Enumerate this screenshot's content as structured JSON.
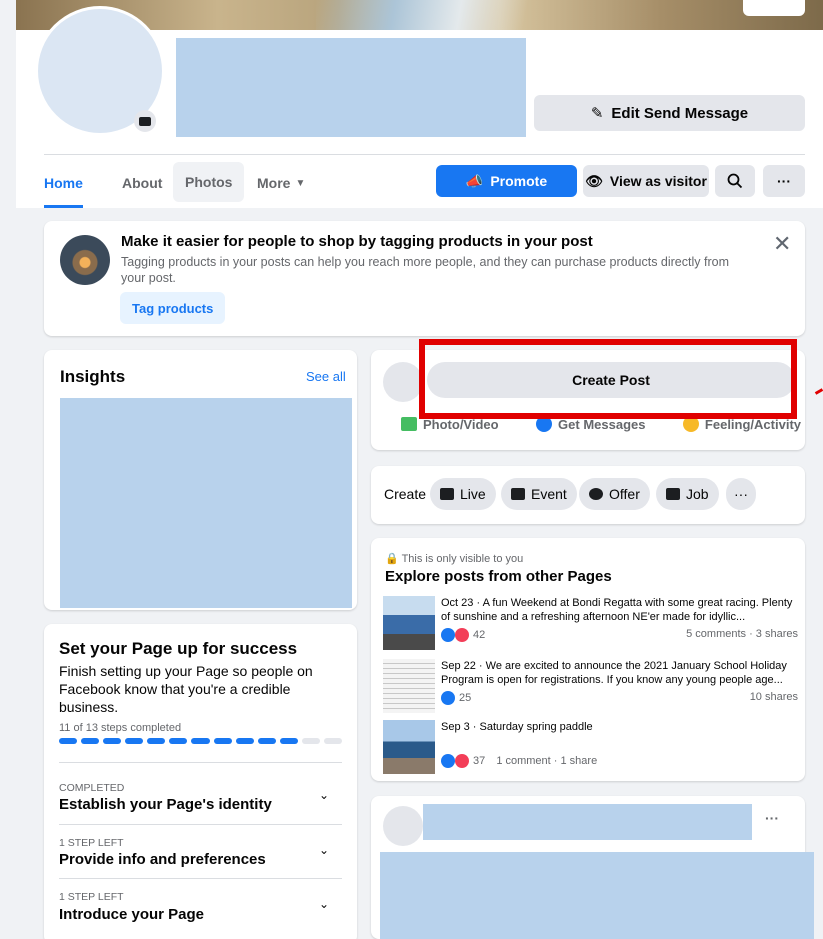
{
  "header": {
    "edit_button_label": "Edit Send Message"
  },
  "tabs": [
    {
      "label": "Home"
    },
    {
      "label": "About"
    },
    {
      "label": "Photos"
    },
    {
      "label": "More"
    }
  ],
  "actions": {
    "promote_label": "Promote",
    "visitor_label": "View as visitor"
  },
  "tag_card": {
    "title": "Make it easier for people to shop by tagging products in your post",
    "description": "Tagging products in your posts can help you reach more people, and they can purchase products directly from your post.",
    "button_label": "Tag products"
  },
  "insights": {
    "title": "Insights",
    "see_all": "See all"
  },
  "setup": {
    "title": "Set your Page up for success",
    "description": "Finish setting up your Page so people on Facebook know that you're a credible business.",
    "steps_completed": "11 of 13 steps completed",
    "progress_done": 11,
    "progress_total": 13,
    "steps": [
      {
        "status": "COMPLETED",
        "label": "Establish your Page's identity"
      },
      {
        "status": "1 STEP LEFT",
        "label": "Provide info and preferences"
      },
      {
        "status": "1 STEP LEFT",
        "label": "Introduce your Page"
      }
    ]
  },
  "create_post": {
    "button_label": "Create Post",
    "options": [
      "Photo/Video",
      "Get Messages",
      "Feeling/Activity"
    ]
  },
  "create_row": {
    "label": "Create",
    "chips": [
      "Live",
      "Event",
      "Offer",
      "Job"
    ],
    "more": "···"
  },
  "explore": {
    "visibility_note": "This is only visible to you",
    "title": "Explore posts from other Pages",
    "posts": [
      {
        "text": "Oct 23 · A fun Weekend at Bondi Regatta with some great racing. Plenty of sunshine and a refreshing afternoon NE'er made for idyllic...",
        "reactions": "42",
        "stats": "5 comments · 3 shares"
      },
      {
        "text": "Sep 22 · We are excited to announce the 2021 January School Holiday Program is open for registrations. If you know any young people age...",
        "reactions": "25",
        "stats": "10 shares"
      },
      {
        "text": "Sep 3 · Saturday spring paddle",
        "reactions": "37",
        "stats": "1 comment · 1 share"
      }
    ]
  },
  "post_card": {
    "more": "···"
  },
  "colors": {
    "brand_blue": "#1877f2",
    "annotation_red": "#e00000",
    "placeholder_blue": "#b8d2ec"
  }
}
